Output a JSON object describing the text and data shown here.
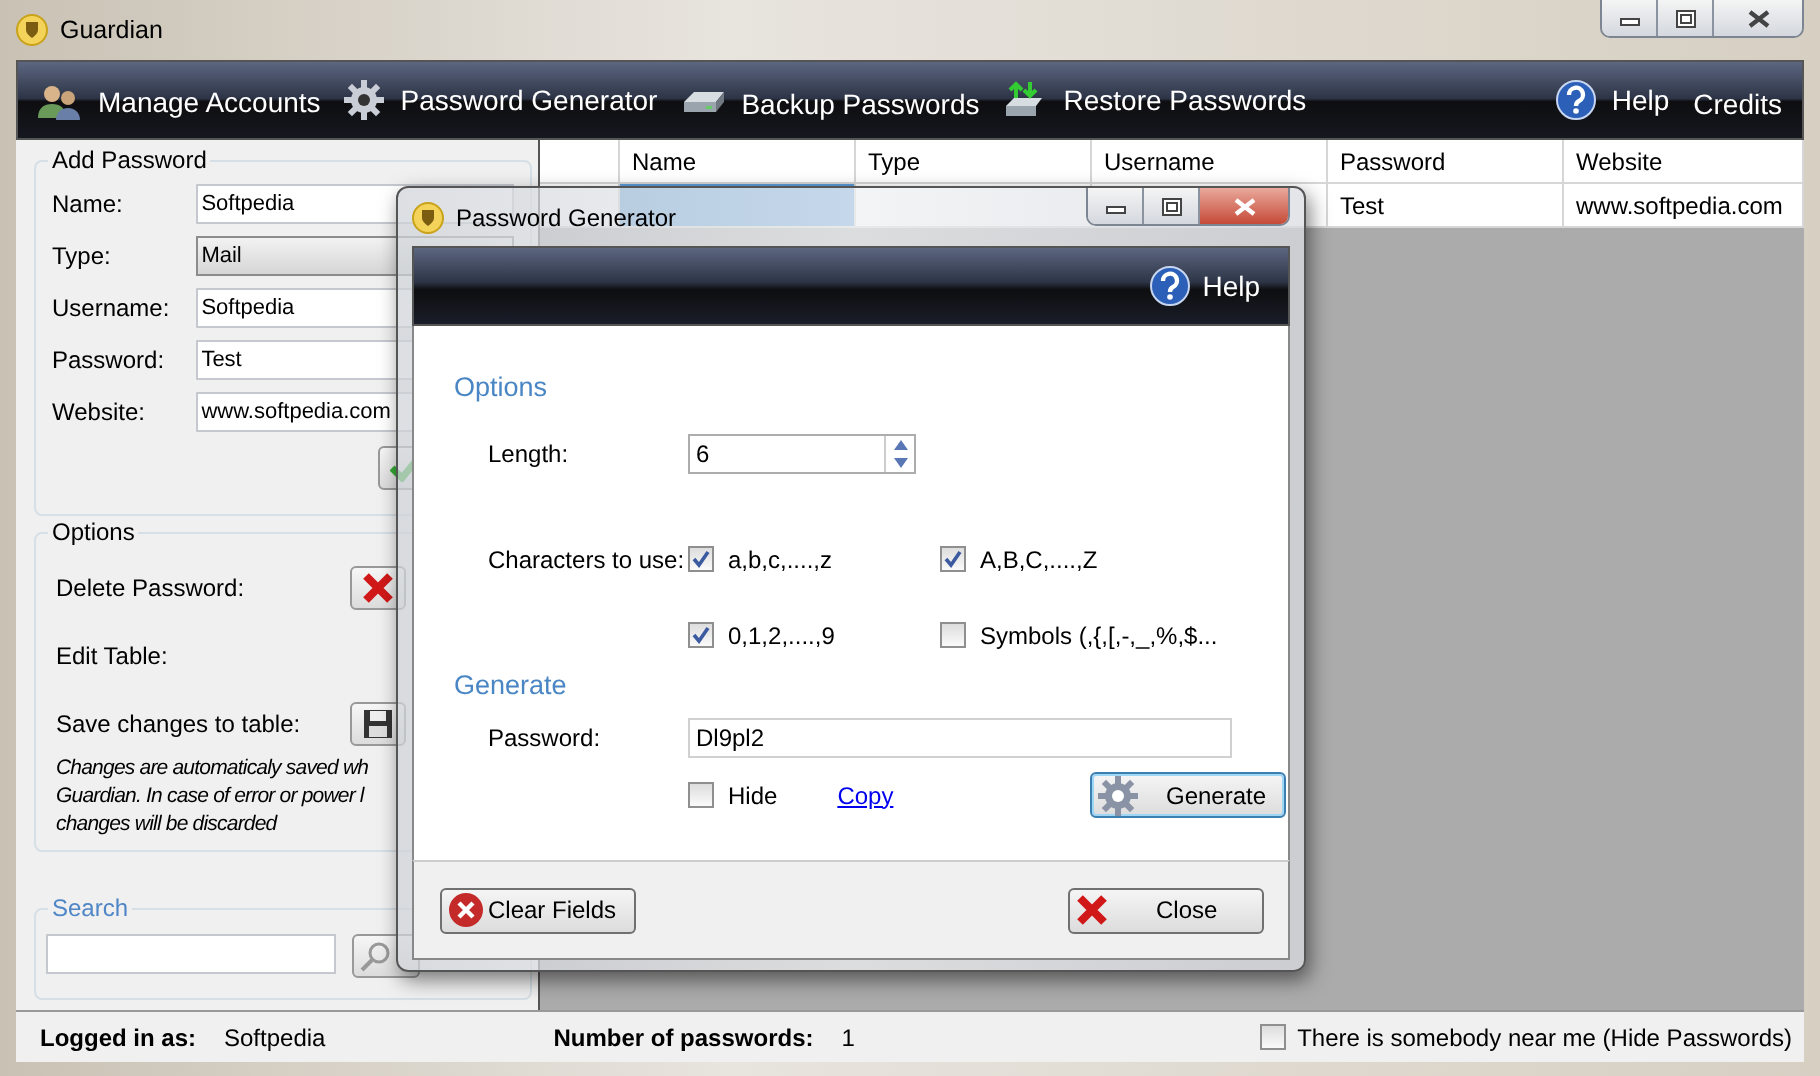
{
  "window": {
    "title": "Guardian"
  },
  "toolbar": {
    "items": [
      {
        "label": "Manage Accounts",
        "kind": "accounts"
      },
      {
        "label": "Password Generator",
        "kind": "gear"
      },
      {
        "label": "Backup Passwords",
        "kind": "drive"
      },
      {
        "label": "Restore Passwords",
        "kind": "restore"
      }
    ],
    "right": [
      {
        "label": "Help",
        "kind": "help"
      },
      {
        "label": "Credits",
        "kind": "plain"
      }
    ]
  },
  "add_password": {
    "title": "Add Password",
    "fields": [
      {
        "label": "Name:",
        "value": "Softpedia",
        "kind": "text"
      },
      {
        "label": "Type:",
        "value": "Mail",
        "kind": "dropdown"
      },
      {
        "label": "Username:",
        "value": "Softpedia",
        "kind": "text"
      },
      {
        "label": "Password:",
        "value": "Test",
        "kind": "text"
      },
      {
        "label": "Website:",
        "value": "www.softpedia.com",
        "kind": "text"
      }
    ]
  },
  "options": {
    "title": "Options",
    "rows": [
      {
        "label": "Delete Password:",
        "kind": "delete"
      },
      {
        "label": "Edit Table:",
        "kind": "plain"
      },
      {
        "label": "Save changes to table:",
        "kind": "save"
      }
    ],
    "note": [
      "Changes are automaticaly saved wh",
      "Guardian. In case of error or power l",
      "changes will be discarded"
    ]
  },
  "search": {
    "title": "Search"
  },
  "table": {
    "columns": [
      "Name",
      "Type",
      "Username",
      "Password",
      "Website"
    ],
    "rows": [
      {
        "selected": true,
        "password": "Test",
        "website": "www.softpedia.com"
      }
    ]
  },
  "status_bar": {
    "logged_in_label": "Logged in as:",
    "logged_in_value": "Softpedia",
    "count_label": "Number of passwords:",
    "count_value": "1",
    "hide": {
      "label": "There is somebody near me (Hide Passwords)",
      "checked": false
    }
  },
  "dialog": {
    "title": "Password Generator",
    "help": "Help",
    "options_title": "Options",
    "length_label": "Length:",
    "length_value": "6",
    "chars_label": "Characters to use:",
    "charsets": [
      {
        "label": "a,b,c,....,z",
        "checked": true
      },
      {
        "label": "A,B,C,....,Z",
        "checked": true
      },
      {
        "label": "0,1,2,....,9",
        "checked": true
      },
      {
        "label": "Symbols (,{,[,-,_,%,$...",
        "checked": false
      }
    ],
    "generate_title": "Generate",
    "password_label": "Password:",
    "password_value": "Dl9pl2",
    "hide": {
      "label": "Hide",
      "checked": false
    },
    "copy": "Copy",
    "generate_button": "Generate",
    "clear_button": "Clear Fields",
    "close_button": "Close"
  }
}
